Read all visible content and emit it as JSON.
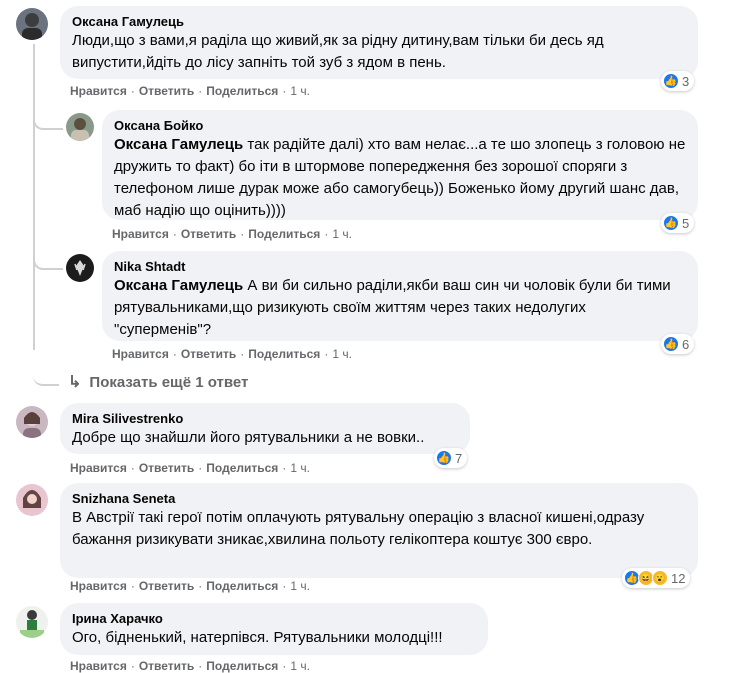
{
  "labels": {
    "like": "Нравится",
    "reply": "Ответить",
    "share": "Поделиться",
    "dot": "·"
  },
  "colors": {
    "bubble": "#f0f2f5",
    "meta": "#65676b",
    "like": "#1877f2"
  },
  "comments": [
    {
      "author": "Оксана Гамулець",
      "text": "Люди,що з вами,я раділа що живий,як за рідну дитину,вам тільки би десь яд випустити,йдіть до лісу запніть той зуб з ядом в пень.",
      "time": "1 ч.",
      "reactions": [
        "like"
      ],
      "count": "3"
    },
    {
      "author": "Оксана Бойко",
      "mention": "Оксана Гамулець",
      "text": " так радійте далі) хто вам нелає...а те шо злопець з головою не дружить то факт) бо іти в штормове попередження без зорошої споряги з телефоном лише дурак може або самогубець)) Боженько йому другий шанс дав, маб надію що оцінить))))",
      "time": "1 ч.",
      "reactions": [
        "like"
      ],
      "count": "5"
    },
    {
      "author": "Nika Shtadt",
      "mention": "Оксана Гамулець",
      "text": " А ви би сильно раділи,якби ваш син чи чоловік були би тими рятувальниками,що ризикують своїм життям через таких недолугих \"суперменів\"?",
      "time": "1 ч.",
      "reactions": [
        "like"
      ],
      "count": "6"
    },
    {
      "author": "Mira Silivestrenko",
      "text": "Добре що знайшли його рятувальники а не вовки..",
      "time": "1 ч.",
      "reactions": [
        "like"
      ],
      "count": "7"
    },
    {
      "author": "Snizhana Seneta",
      "text": "В Австрії такі герої потім оплачують рятувальну операцію з власної кишені,одразу бажання ризикувати зникає,хвилина польоту гелікоптера коштує 300 євро.",
      "time": "1 ч.",
      "reactions": [
        "like",
        "haha",
        "wow"
      ],
      "count": "12"
    },
    {
      "author": "Ірина Харачко",
      "text": "Ого, бідненький, натерпівся. Рятувальники молодці!!!",
      "time": "1 ч."
    }
  ],
  "show_more": "Показать ещё 1 ответ"
}
